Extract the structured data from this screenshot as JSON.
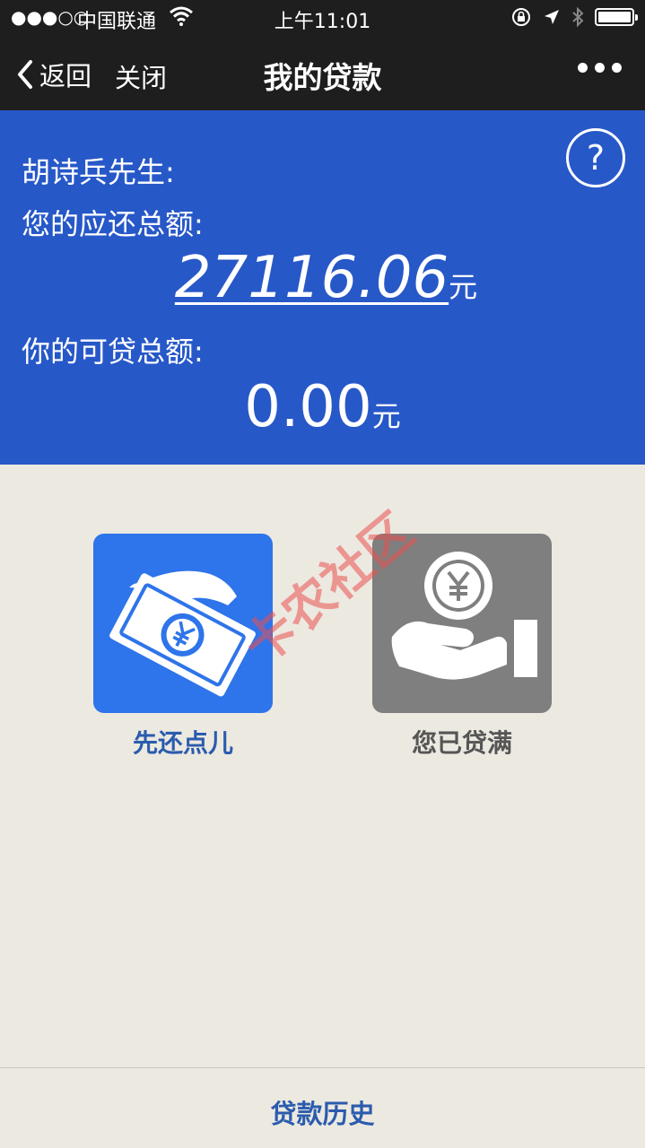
{
  "status_bar": {
    "signal": "●●●○○",
    "carrier": "中国联通",
    "time": "上午11:01"
  },
  "nav": {
    "back_label": "返回",
    "close_label": "关闭",
    "title": "我的贷款"
  },
  "summary": {
    "help_symbol": "?",
    "greeting": "胡诗兵先生:",
    "due_label": "您的应还总额:",
    "due_amount": "27116.06",
    "due_unit": "元",
    "available_label": "你的可贷总额:",
    "available_amount": "0.00",
    "available_unit": "元"
  },
  "actions": [
    {
      "label": "先还点儿",
      "icon": "repay-cash-icon",
      "color": "#2e74ea"
    },
    {
      "label": "您已贷满",
      "icon": "hand-coin-icon",
      "color": "#7f7f7f"
    }
  ],
  "watermark": "卡农社区",
  "bottom": {
    "history_label": "贷款历史"
  },
  "colors": {
    "nav_bg": "#1e1e1e",
    "summary_bg": "#2758c8",
    "page_bg": "#ece9e1",
    "link_blue": "#2b5cad"
  }
}
